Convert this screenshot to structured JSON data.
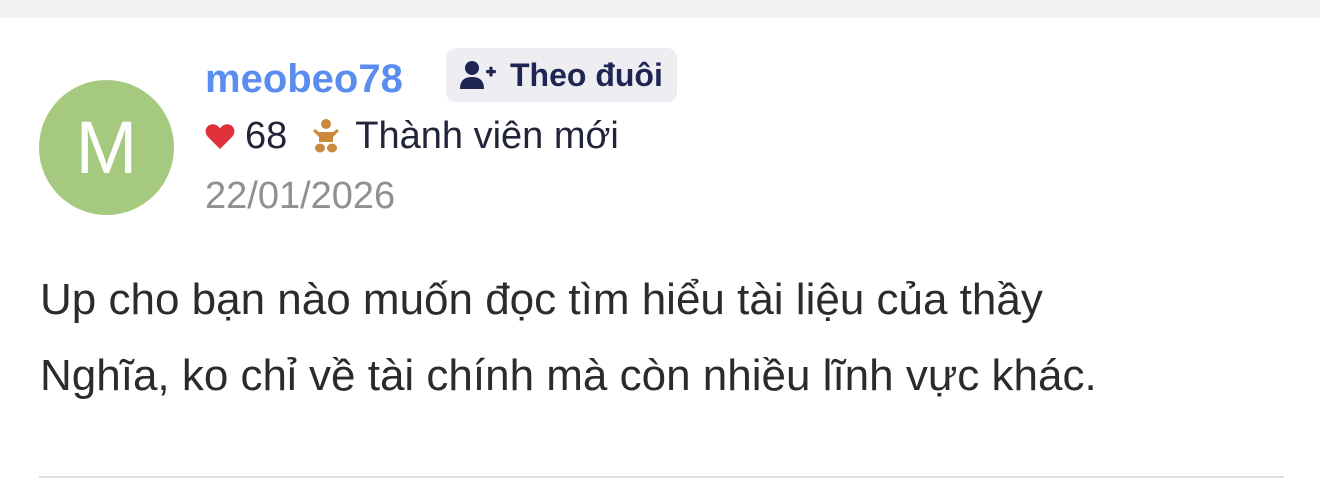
{
  "post": {
    "avatar_letter": "M",
    "username": "meobeo78",
    "follow_label": "Theo đuôi",
    "likes": "68",
    "rank": "Thành viên mới",
    "date": "22/01/2026",
    "content_lines": [
      "Up cho bạn nào muốn đọc tìm hiểu tài liệu của thầy",
      "Nghĩa, ko chỉ về tài chính mà còn nhiều lĩnh vực khác."
    ]
  },
  "icons": {
    "follow": "user-plus-icon",
    "likes": "heart-icon",
    "rank": "baby-icon"
  },
  "colors": {
    "avatar": "#a5c97f",
    "username": "#5b8def",
    "heart": "#e0303a",
    "follow_bg": "#eeeef2",
    "follow_text": "#1f2553",
    "baby": "#c98a3c"
  }
}
